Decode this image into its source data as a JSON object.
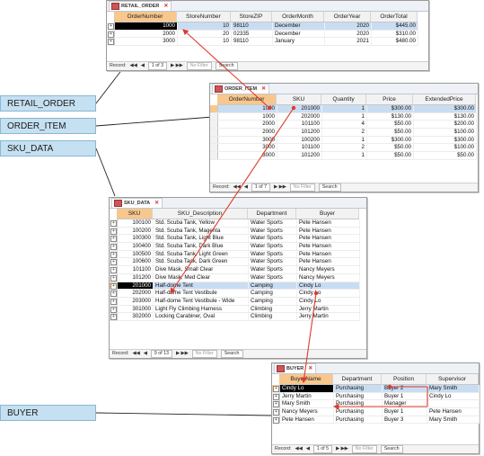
{
  "labels": {
    "retail_order": "RETAIL_ORDER",
    "order_item": "ORDER_ITEM",
    "sku_data": "SKU_DATA",
    "buyer": "BUYER"
  },
  "retail_order": {
    "tab": "RETAIL_ORDER",
    "columns": [
      "OrderNumber",
      "StoreNumber",
      "StoreZIP",
      "OrderMonth",
      "OrderYear",
      "OrderTotal"
    ],
    "rows": [
      [
        "1000",
        "10",
        "98110",
        "December",
        "2020",
        "$445.00"
      ],
      [
        "2000",
        "20",
        "02335",
        "December",
        "2020",
        "$310.00"
      ],
      [
        "3000",
        "10",
        "98110",
        "January",
        "2021",
        "$480.00"
      ]
    ],
    "nav": {
      "record": "Record:",
      "position": "1 of 3",
      "nofilter": "No Filter",
      "search": "Search"
    }
  },
  "order_item": {
    "tab": "ORDER_ITEM",
    "columns": [
      "OrderNumber",
      "SKU",
      "Quantity",
      "Price",
      "ExtendedPrice"
    ],
    "rows": [
      [
        "1000",
        "201000",
        "1",
        "$300.00",
        "$300.00"
      ],
      [
        "1000",
        "202000",
        "1",
        "$130.00",
        "$130.00"
      ],
      [
        "2000",
        "101100",
        "4",
        "$50.00",
        "$200.00"
      ],
      [
        "2000",
        "101200",
        "2",
        "$50.00",
        "$100.00"
      ],
      [
        "3000",
        "100200",
        "1",
        "$300.00",
        "$300.00"
      ],
      [
        "3000",
        "101100",
        "2",
        "$50.00",
        "$100.00"
      ],
      [
        "3000",
        "101200",
        "1",
        "$50.00",
        "$50.00"
      ]
    ],
    "nav": {
      "record": "Record:",
      "position": "1 of 7",
      "nofilter": "No Filter",
      "search": "Search"
    }
  },
  "sku_data": {
    "tab": "SKU_DATA",
    "columns": [
      "SKU",
      "SKU_Description",
      "Department",
      "Buyer"
    ],
    "rows": [
      [
        "100100",
        "Std. Scuba Tank, Yellow",
        "Water Sports",
        "Pete Hansen"
      ],
      [
        "100200",
        "Std. Scuba Tank, Magenta",
        "Water Sports",
        "Pete Hansen"
      ],
      [
        "100300",
        "Std. Scuba Tank, Light Blue",
        "Water Sports",
        "Pete Hansen"
      ],
      [
        "100400",
        "Std. Scuba Tank, Dark Blue",
        "Water Sports",
        "Pete Hansen"
      ],
      [
        "100500",
        "Std. Scuba Tank, Light Green",
        "Water Sports",
        "Pete Hansen"
      ],
      [
        "100600",
        "Std. Scuba Tank, Dark Green",
        "Water Sports",
        "Pete Hansen"
      ],
      [
        "101100",
        "Dive Mask, Small Clear",
        "Water Sports",
        "Nancy Meyers"
      ],
      [
        "101200",
        "Dive Mask, Med Clear",
        "Water Sports",
        "Nancy Meyers"
      ],
      [
        "201000",
        "Half-dome Tent",
        "Camping",
        "Cindy Lo"
      ],
      [
        "202000",
        "Half-dome Tent Vestibule",
        "Camping",
        "Cindy Lo"
      ],
      [
        "203000",
        "Half-dome Tent Vestibule - Wide",
        "Camping",
        "Cindy Lo"
      ],
      [
        "301000",
        "Light Fly Climbing Harness",
        "Climbing",
        "Jerry Martin"
      ],
      [
        "302000",
        "Locking Carabiner, Oval",
        "Climbing",
        "Jerry Martin"
      ]
    ],
    "nav": {
      "record": "Record:",
      "position": "9 of 13",
      "nofilter": "No Filter",
      "search": "Search"
    }
  },
  "buyer": {
    "tab": "BUYER",
    "columns": [
      "BuyerName",
      "Department",
      "Position",
      "Supervisor"
    ],
    "rows": [
      [
        "Cindy Lo",
        "Purchasing",
        "Buyer 2",
        "Mary Smith"
      ],
      [
        "Jerry Martin",
        "Purchasing",
        "Buyer 1",
        "Cindy Lo"
      ],
      [
        "Mary Smith",
        "Purchasing",
        "Manager",
        ""
      ],
      [
        "Nancy Meyers",
        "Purchasing",
        "Buyer 1",
        "Pete Hansen"
      ],
      [
        "Pete Hansen",
        "Purchasing",
        "Buyer 3",
        "Mary Smith"
      ]
    ],
    "nav": {
      "record": "Record:",
      "position": "1 of 5",
      "nofilter": "No Filter",
      "search": "Search"
    }
  },
  "colors": {
    "arrow": "#e0392b",
    "label_bg": "#c5e0f1",
    "highlight": "#c9ddf2",
    "header_sel": "#f7c78d"
  }
}
